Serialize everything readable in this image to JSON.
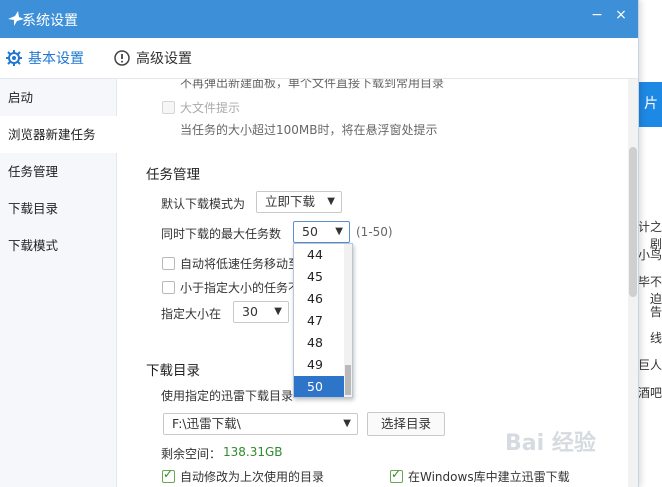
{
  "background": {
    "side_snippets": [
      "计之剧",
      "小鸟",
      "毕不迫",
      "告",
      "线",
      "巨人",
      "酒吧"
    ],
    "blue_tab_text": "片"
  },
  "window": {
    "title": "系统设置",
    "controls": {
      "minimize": "−",
      "close": "×"
    },
    "colors": {
      "titlebar": "#3d8fd8",
      "accent": "#1f78d1",
      "selected": "#2e74c9",
      "green": "#2e8b2e"
    }
  },
  "tabs": [
    {
      "label": "基本设置",
      "icon": "gear-icon",
      "active": true
    },
    {
      "label": "高级设置",
      "icon": "info-icon",
      "active": false
    }
  ],
  "sidebar": {
    "items": [
      {
        "label": "启动"
      },
      {
        "label": "浏览器新建任务",
        "active": true
      },
      {
        "label": "任务管理"
      },
      {
        "label": "下载目录"
      },
      {
        "label": "下载模式"
      }
    ]
  },
  "browser_task": {
    "clipped_text": "不再弹出新建面板，单个文件直接下载到常用目录",
    "large_file_label": "大文件提示",
    "large_file_desc": "当任务的大小超过100MB时，将在悬浮窗处提示"
  },
  "task_mgmt": {
    "title": "任务管理",
    "default_mode_label": "默认下载模式为",
    "default_mode_value": "立即下载",
    "max_tasks_label": "同时下载的最大任务数",
    "max_tasks_value": "50",
    "max_tasks_range": "(1-50)",
    "auto_move_label": "自动将低速任务移动至",
    "small_task_label": "小于指定大小的任务不",
    "size_label": "指定大小在",
    "size_value": "30"
  },
  "dropdown": {
    "options": [
      "44",
      "45",
      "46",
      "47",
      "48",
      "49",
      "50"
    ],
    "selected": "50"
  },
  "download_dir": {
    "title": "下载目录",
    "use_dir_label": "使用指定的迅雷下载目录",
    "path_value": "F:\\迅雷下载\\",
    "choose_button": "选择目录",
    "free_space_label": "剩余空间：",
    "free_space_value": "138.31GB",
    "auto_modify_label": "自动修改为上次使用的目录",
    "win_lib_label": "在Windows库中建立迅雷下载"
  },
  "watermark": "Bai 经验"
}
